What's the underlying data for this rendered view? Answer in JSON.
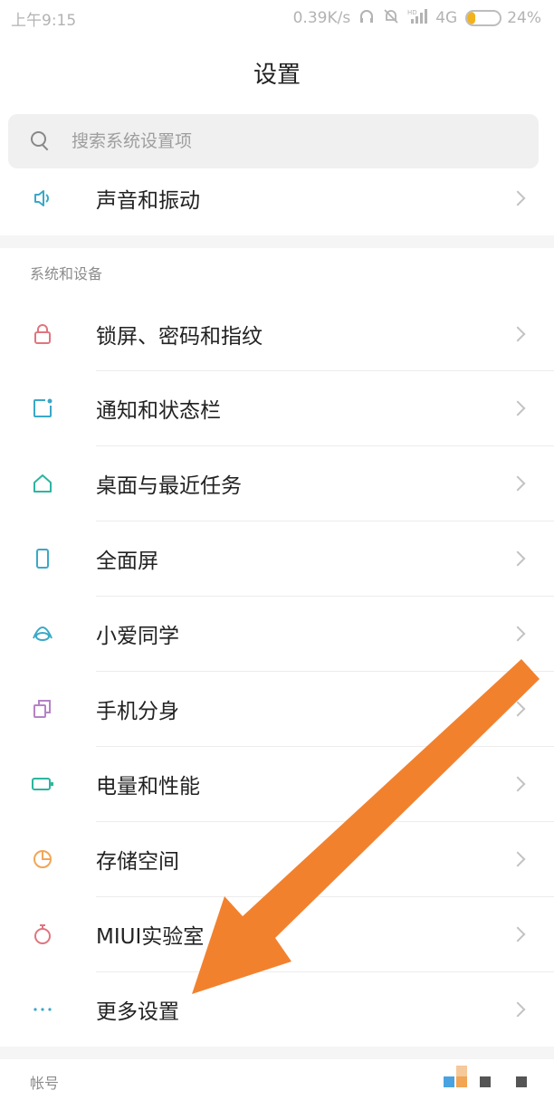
{
  "status_bar": {
    "time": "上午9:15",
    "speed": "0.39K/s",
    "network": "4G",
    "battery_percent": "24%",
    "battery_level": 0.24,
    "icons": [
      "headphones-icon",
      "mute-bell-icon",
      "hd-signal-icon",
      "battery-icon"
    ]
  },
  "header": {
    "title": "设置"
  },
  "search": {
    "placeholder": "搜索系统设置项"
  },
  "top_item": {
    "label": "声音和振动",
    "icon": "speaker-icon"
  },
  "section": {
    "header": "系统和设备",
    "items": [
      {
        "label": "锁屏、密码和指纹",
        "icon": "lock-icon",
        "color": "#e0757e"
      },
      {
        "label": "通知和状态栏",
        "icon": "notification-icon",
        "color": "#3aa8c8"
      },
      {
        "label": "桌面与最近任务",
        "icon": "home-icon",
        "color": "#2db5a0"
      },
      {
        "label": "全面屏",
        "icon": "phone-icon",
        "color": "#3aa8c8"
      },
      {
        "label": "小爱同学",
        "icon": "xiaoai-icon",
        "color": "#3aa8c8"
      },
      {
        "label": "手机分身",
        "icon": "clone-icon",
        "color": "#b583c6"
      },
      {
        "label": "电量和性能",
        "icon": "battery-icon",
        "color": "#2db5a0"
      },
      {
        "label": "存储空间",
        "icon": "storage-pie-icon",
        "color": "#f0a657"
      },
      {
        "label": "MIUI实验室",
        "icon": "lab-flask-icon",
        "color": "#e0757e"
      },
      {
        "label": "更多设置",
        "icon": "more-dots-icon",
        "color": "#3aa8c8"
      }
    ]
  },
  "account_section": {
    "header": "帐号"
  },
  "colors": {
    "arrow": "#f2812e",
    "accent_teal": "#3aa8c8"
  }
}
